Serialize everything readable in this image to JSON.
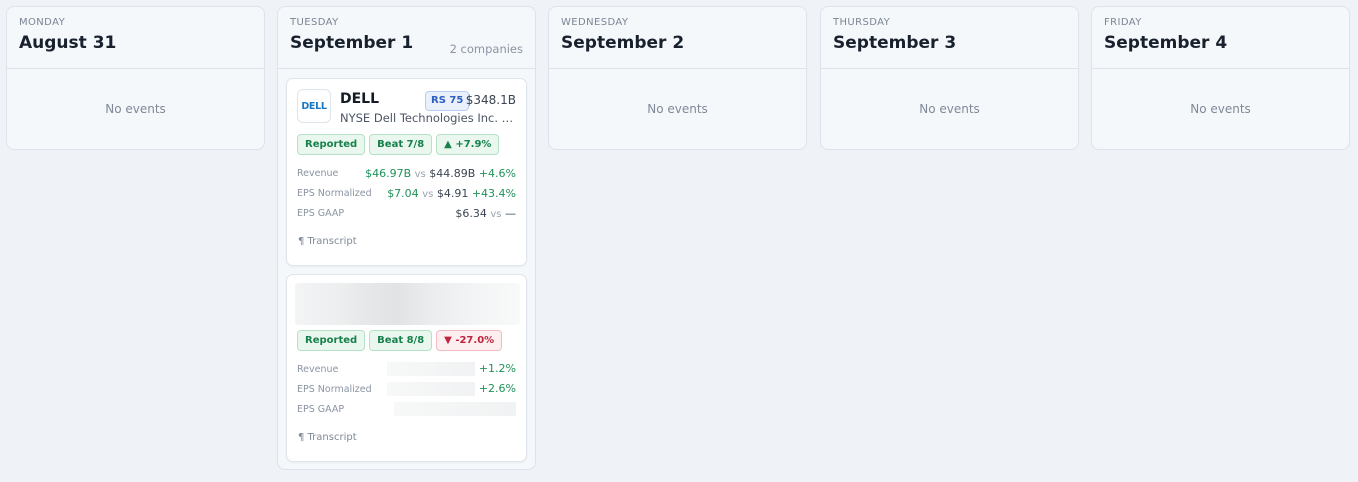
{
  "days": [
    {
      "weekday": "MONDAY",
      "date": "August 31",
      "empty": "No events"
    },
    {
      "weekday": "TUESDAY",
      "date": "September 1",
      "count": "2 companies"
    },
    {
      "weekday": "WEDNESDAY",
      "date": "September 2",
      "empty": "No events"
    },
    {
      "weekday": "THURSDAY",
      "date": "September 3",
      "empty": "No events"
    },
    {
      "weekday": "FRIDAY",
      "date": "September 4",
      "empty": "No events"
    }
  ],
  "cards": [
    {
      "logo_text": "DELL",
      "ticker": "DELL",
      "rs": "RS 75",
      "market_cap": "$348.1B",
      "subtitle": "NYSE  Dell Technologies Inc. Class C",
      "badges": [
        "Reported",
        "Beat 7/8",
        "▲ +7.9%"
      ],
      "metrics": [
        {
          "label": "Revenue",
          "actual": "$46.97B",
          "vs": "vs",
          "estimate": "$44.89B",
          "surprise": "+4.6%"
        },
        {
          "label": "EPS Normalized",
          "actual": "$7.04",
          "vs": "vs",
          "estimate": "$4.91",
          "surprise": "+43.4%"
        },
        {
          "label": "EPS GAAP",
          "actual": "$6.34",
          "vs": "vs",
          "estimate": "—",
          "surprise": ""
        }
      ],
      "transcript": "¶ Transcript"
    },
    {
      "badges": [
        "Reported",
        "Beat 8/8",
        "▼ -27.0%"
      ],
      "metrics": [
        {
          "label": "Revenue",
          "surprise": "+1.2%"
        },
        {
          "label": "EPS Normalized",
          "surprise": "+2.6%"
        },
        {
          "label": "EPS GAAP",
          "surprise": ""
        }
      ],
      "transcript": "¶ Transcript"
    }
  ]
}
